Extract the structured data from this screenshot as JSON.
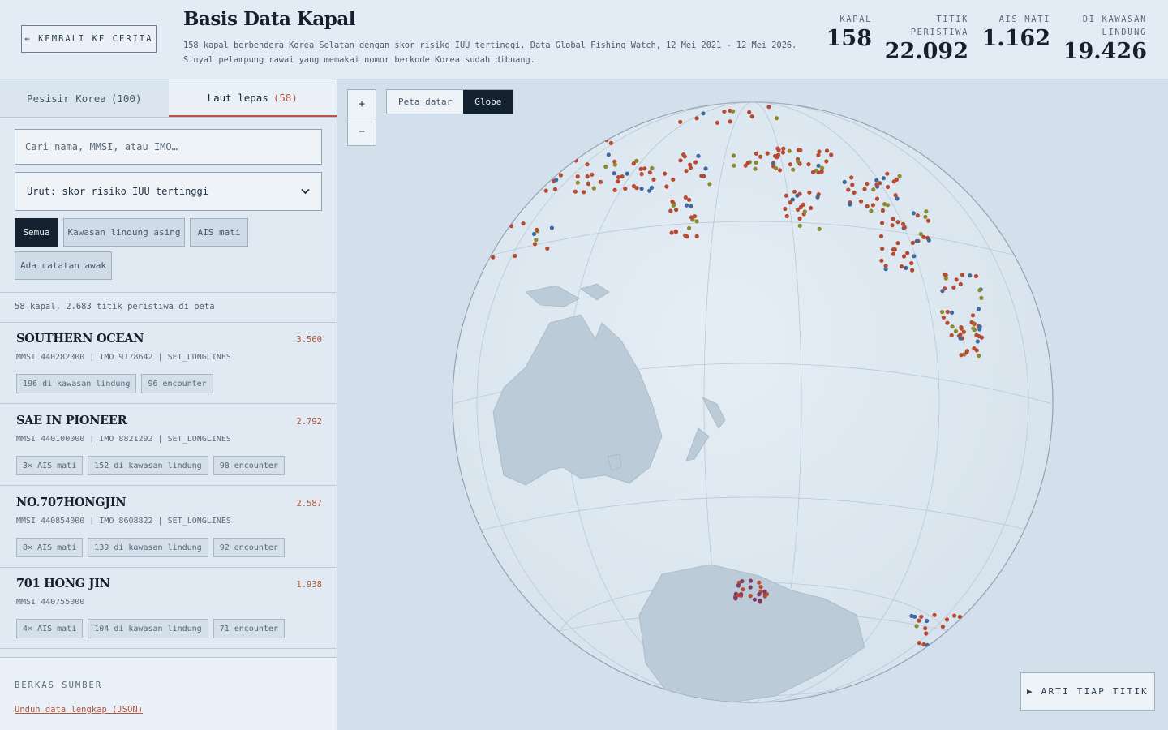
{
  "header": {
    "back_label": "← KEMBALI KE CERITA",
    "title": "Basis Data Kapal",
    "description_line1": "158 kapal berbendera Korea Selatan dengan skor risiko IUU tertinggi. Data Global Fishing Watch, 12 Mei 2021 - 12 Mei 2026.",
    "description_line2": "Sinyal pelampung rawai yang memakai nomor berkode Korea sudah dibuang.",
    "stats": [
      {
        "label": "KAPAL",
        "value": "158"
      },
      {
        "label_line1": "TITIK",
        "label_line2": "PERISTIWA",
        "value": "22.092"
      },
      {
        "label": "AIS MATI",
        "value": "1.162"
      },
      {
        "label_line1": "DI KAWASAN",
        "label_line2": "LINDUNG",
        "value": "19.426"
      }
    ]
  },
  "sidebar": {
    "tabs": [
      {
        "label": "Pesisir Korea",
        "count": "(100)"
      },
      {
        "label": "Laut lepas",
        "count": "(58)"
      }
    ],
    "search_placeholder": "Cari nama, MMSI, atau IMO…",
    "sort_label": "Urut: skor risiko IUU tertinggi",
    "filters": [
      "Semua",
      "Kawasan lindung asing",
      "AIS mati",
      "Ada catatan awak"
    ],
    "summary": "58 kapal, 2.683 titik peristiwa di peta",
    "vessels": [
      {
        "name": "SOUTHERN OCEAN",
        "score": "3.560",
        "meta": "MMSI 440282000 | IMO 9178642 | SET_LONGLINES",
        "tags": [
          "196 di kawasan lindung",
          "96 encounter"
        ]
      },
      {
        "name": "SAE IN PIONEER",
        "score": "2.792",
        "meta": "MMSI 440100000 | IMO 8821292 | SET_LONGLINES",
        "tags": [
          "3× AIS mati",
          "152 di kawasan lindung",
          "98 encounter"
        ]
      },
      {
        "name": "NO.707HONGJIN",
        "score": "2.587",
        "meta": "MMSI 440854000 | IMO 8608822 | SET_LONGLINES",
        "tags": [
          "8× AIS mati",
          "139 di kawasan lindung",
          "92 encounter"
        ]
      },
      {
        "name": "701 HONG JIN",
        "score": "1.938",
        "meta": "MMSI 440755000",
        "tags": [
          "4× AIS mati",
          "104 di kawasan lindung",
          "71 encounter"
        ]
      }
    ],
    "source_label": "BERKAS SUMBER",
    "source_link": "Unduh data lengkap (JSON)"
  },
  "map": {
    "zoom_in": "+",
    "zoom_out": "−",
    "projections": [
      "Peta datar",
      "Globe"
    ],
    "legend_button": "▶ ARTI TIAP TITIK",
    "colors": {
      "ocean": "#dde7f0",
      "land": "#bccbd8",
      "event_red": "#b84a32",
      "event_blue": "#3e6aa0",
      "event_olive": "#8b8a2f",
      "event_purple": "#7a3a6a"
    }
  }
}
